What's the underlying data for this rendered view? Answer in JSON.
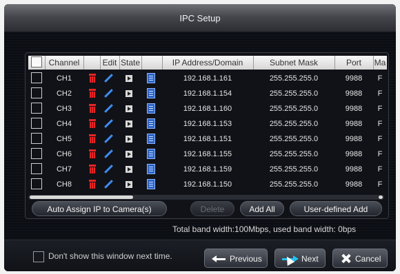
{
  "window": {
    "title": "IPC Setup"
  },
  "table": {
    "headers": [
      "Channel",
      "Edit",
      "State",
      "IP Address/Domain",
      "Subnet Mask",
      "Port",
      "Ma"
    ],
    "rows": [
      {
        "channel": "CH1",
        "ip": "192.168.1.161",
        "mask": "255.255.255.0",
        "port": "9988",
        "ma": "F"
      },
      {
        "channel": "CH2",
        "ip": "192.168.1.154",
        "mask": "255.255.255.0",
        "port": "9988",
        "ma": "F"
      },
      {
        "channel": "CH3",
        "ip": "192.168.1.160",
        "mask": "255.255.255.0",
        "port": "9988",
        "ma": "F"
      },
      {
        "channel": "CH4",
        "ip": "192.168.1.153",
        "mask": "255.255.255.0",
        "port": "9988",
        "ma": "F"
      },
      {
        "channel": "CH5",
        "ip": "192.168.1.151",
        "mask": "255.255.255.0",
        "port": "9988",
        "ma": "F"
      },
      {
        "channel": "CH6",
        "ip": "192.168.1.155",
        "mask": "255.255.255.0",
        "port": "9988",
        "ma": "F"
      },
      {
        "channel": "CH7",
        "ip": "192.168.1.159",
        "mask": "255.255.255.0",
        "port": "9988",
        "ma": "F"
      },
      {
        "channel": "CH8",
        "ip": "192.168.1.150",
        "mask": "255.255.255.0",
        "port": "9988",
        "ma": "F"
      }
    ]
  },
  "actions": {
    "auto_assign": "Auto Assign IP to Camera(s)",
    "delete": "Delete",
    "add_all": "Add All",
    "user_defined_add": "User-defined Add"
  },
  "bandwidth_text": "Total band width:100Mbps, used band width: 0bps",
  "footer": {
    "dont_show": "Don't show this window next time.",
    "previous": "Previous",
    "next": "Next",
    "cancel": "Cancel"
  },
  "icons": {
    "delete_row": "trash-icon",
    "edit_row": "pencil-icon",
    "state": "play-icon",
    "config": "document-edit-icon",
    "previous": "arrow-left-icon",
    "next": "arrow-right-icon",
    "cancel": "close-icon"
  },
  "colors": {
    "accent": "#23c1f2",
    "delete_red": "#e52525",
    "edit_blue": "#3f8cf0"
  }
}
